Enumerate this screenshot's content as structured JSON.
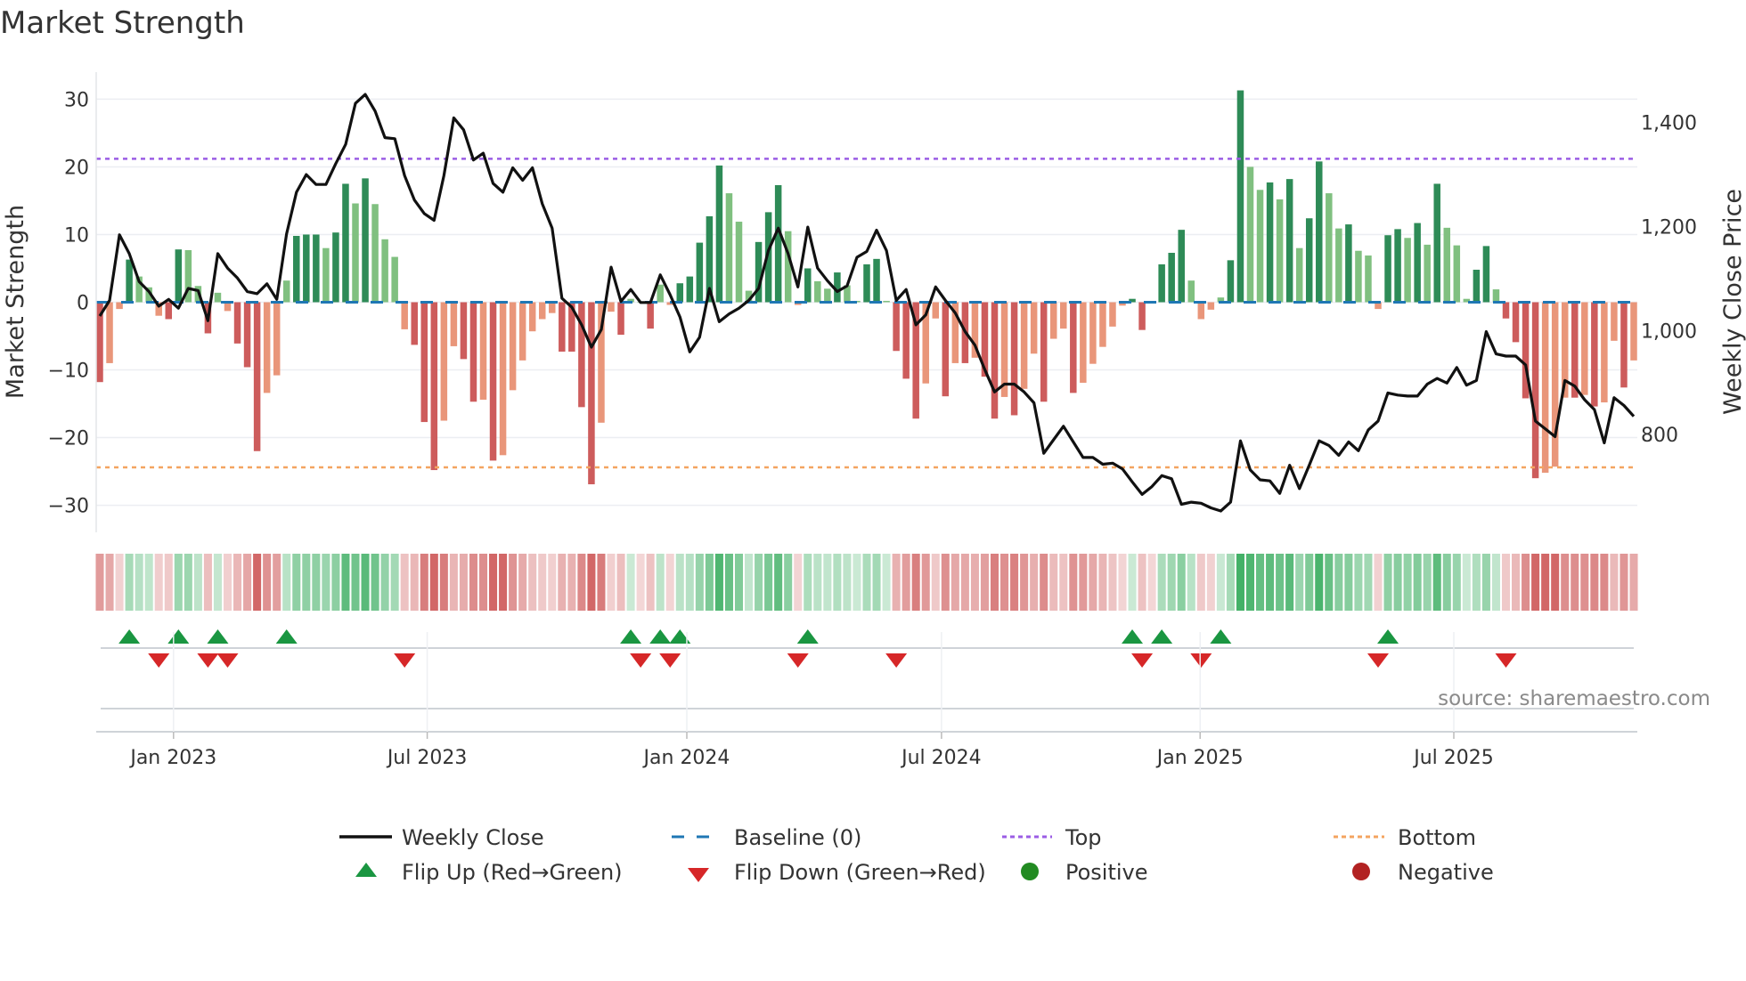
{
  "chart_data": {
    "type": "bar",
    "title": "Market Strength",
    "ylabel": "Market Strength",
    "y2label": "Weekly Close Price",
    "ylim": [
      -34,
      34
    ],
    "y2lim": [
      612,
      1497
    ],
    "yticks": [
      30,
      20,
      10,
      0,
      -10,
      -20,
      -30
    ],
    "yticklabels": [
      "30",
      "20",
      "10",
      "0",
      "−10",
      "−20",
      "−30"
    ],
    "y2ticks": [
      1400,
      1200,
      1000,
      800
    ],
    "y2ticklabels": [
      "1,400",
      "1,200",
      "1,000",
      "800"
    ],
    "xticklabels": [
      "Jan 2023",
      "Jul 2023",
      "Jan 2024",
      "Jul 2024",
      "Jan 2025",
      "Jul 2025"
    ],
    "xtick_bar_index": [
      7.5,
      33.3,
      59.7,
      85.6,
      111.9,
      137.7
    ],
    "top_level": 21.2,
    "bottom_level": -24.4,
    "strength": [
      -11.8,
      -9,
      -1,
      6.3,
      3.8,
      2.2,
      -2,
      -2.5,
      7.8,
      7.7,
      2.4,
      -4.6,
      1.4,
      -1.3,
      -6.1,
      -9.6,
      -22,
      -13.4,
      -10.8,
      3.2,
      9.8,
      10,
      10,
      8,
      10.3,
      17.5,
      14.6,
      18.3,
      14.5,
      9.3,
      6.7,
      -4,
      -6.3,
      -17.7,
      -24.8,
      -17.5,
      -6.5,
      -8.4,
      -14.7,
      -14.4,
      -23.4,
      -22.6,
      -13,
      -8.6,
      -4.3,
      -2.5,
      -1.6,
      -7.3,
      -7.3,
      -15.5,
      -26.9,
      -17.8,
      -1.4,
      -4.8,
      0.5,
      0,
      -3.9,
      2.6,
      -0.4,
      2.8,
      3.8,
      8.8,
      12.7,
      20.2,
      16.1,
      11.9,
      1.7,
      8.9,
      13.3,
      17.3,
      10.5,
      -0.4,
      5,
      3.1,
      2,
      4.4,
      2.5,
      0.2,
      5.6,
      6.4,
      0.2,
      -7.2,
      -11.3,
      -17.2,
      -12,
      -2.4,
      -13.9,
      -9,
      -9,
      -8.2,
      -11,
      -17.2,
      -14,
      -16.7,
      -12.8,
      -7.6,
      -14.7,
      -5.4,
      -3.9,
      -13.4,
      -11.9,
      -9.1,
      -6.6,
      -3.6,
      -0.5,
      0.5,
      -4.1,
      0,
      5.6,
      7.3,
      10.7,
      3.2,
      -2.5,
      -1.1,
      0.7,
      6.2,
      31.3,
      20,
      16.6,
      17.7,
      15.2,
      18.2,
      8,
      12.4,
      20.8,
      16.1,
      10.9,
      11.5,
      7.6,
      6.9,
      -1,
      9.9,
      10.8,
      9.5,
      11.7,
      8.5,
      17.5,
      11,
      8.4,
      0.5,
      4.8,
      8.3,
      1.9,
      -2.4,
      -5.9,
      -14.2,
      -26,
      -25.2,
      -24.3,
      -14.1,
      -14.1,
      -13.7,
      -15.4,
      -14.8,
      -5.7,
      -12.6,
      -8.6
    ],
    "weekly_close": [
      1028,
      1058,
      1184,
      1148,
      1094,
      1075,
      1047,
      1060,
      1043,
      1081,
      1077,
      1019,
      1148,
      1120,
      1101,
      1075,
      1071,
      1090,
      1060,
      1186,
      1266,
      1300,
      1281,
      1281,
      1321,
      1358,
      1437,
      1454,
      1422,
      1371,
      1369,
      1298,
      1251,
      1225,
      1212,
      1298,
      1409,
      1386,
      1328,
      1341,
      1283,
      1266,
      1313,
      1289,
      1313,
      1244,
      1197,
      1062,
      1045,
      1011,
      968,
      1002,
      1122,
      1056,
      1079,
      1054,
      1054,
      1107,
      1069,
      1026,
      959,
      987,
      1081,
      1017,
      1032,
      1043,
      1058,
      1081,
      1154,
      1197,
      1148,
      1084,
      1199,
      1120,
      1096,
      1075,
      1086,
      1141,
      1152,
      1193,
      1154,
      1058,
      1079,
      1011,
      1030,
      1084,
      1058,
      1034,
      998,
      972,
      925,
      882,
      897,
      897,
      882,
      861,
      764,
      790,
      816,
      786,
      756,
      756,
      743,
      745,
      734,
      709,
      685,
      700,
      721,
      715,
      666,
      670,
      668,
      659,
      653,
      670,
      788,
      732,
      713,
      711,
      687,
      741,
      696,
      741,
      788,
      779,
      760,
      786,
      769,
      809,
      826,
      880,
      876,
      874,
      874,
      897,
      908,
      899,
      929,
      895,
      904,
      998,
      955,
      951,
      951,
      934,
      826,
      811,
      796,
      904,
      893,
      867,
      848,
      784,
      871,
      856,
      835
    ],
    "legend": {
      "weekly_close": "Weekly Close",
      "baseline": "Baseline (0)",
      "top": "Top",
      "bottom": "Bottom",
      "flip_up": "Flip Up (Red→Green)",
      "flip_down": "Flip Down (Green→Red)",
      "positive": "Positive",
      "negative": "Negative"
    },
    "source": "source: sharemaestro.com",
    "colors": {
      "pos_strong": "#2e8b57",
      "pos_weak": "#80c080",
      "neg_strong": "#cd5c5c",
      "neg_weak": "#e9967a",
      "line": "#111111",
      "baseline": "#1f77b4",
      "top": "#9b5de5",
      "bottom": "#f4a460",
      "flip_up": "#1a9641",
      "flip_down": "#d62728",
      "positive": "#228b22",
      "negative": "#b22222"
    }
  }
}
